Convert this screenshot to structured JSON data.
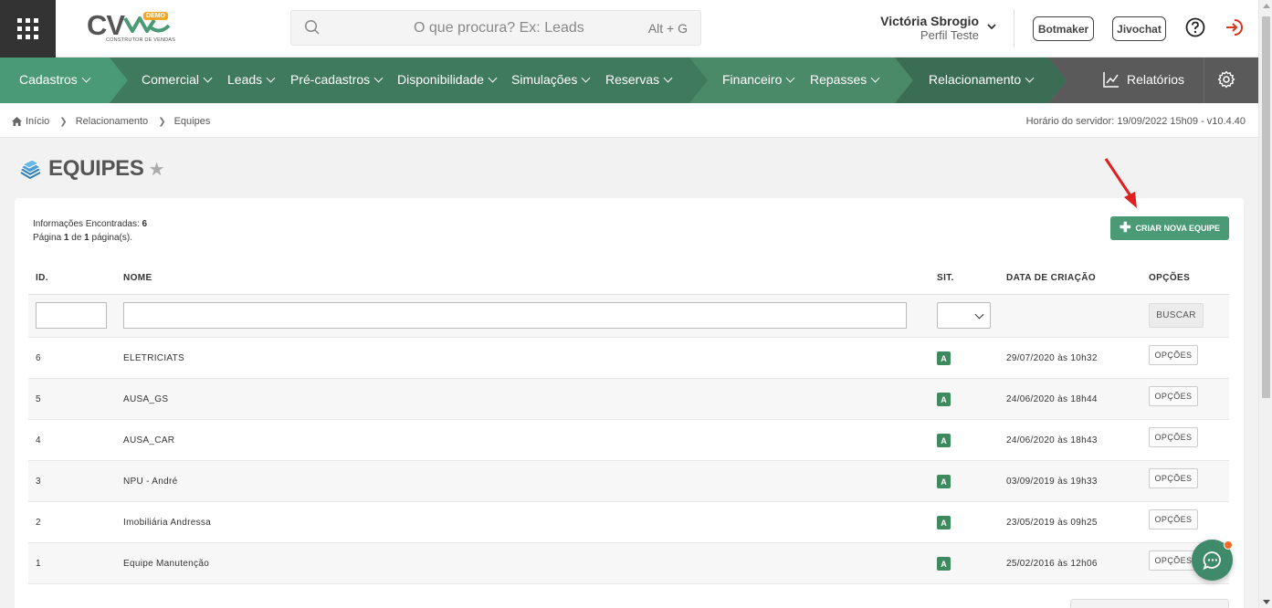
{
  "header": {
    "logo_text": "CV",
    "logo_badge": "DEMO",
    "logo_subtitle": "CONSTRUTOR DE VENDAS",
    "search_placeholder": "O que procura? Ex: Leads",
    "search_shortcut": "Alt + G",
    "user_name": "Victória Sbrogio",
    "user_profile": "Perfil Teste",
    "botmaker_label": "Botmaker",
    "jivochat_label": "Jivochat",
    "icons": [
      "apps-grid-icon",
      "search-icon",
      "chevron-down-icon",
      "help-icon",
      "logout-icon"
    ]
  },
  "nav": {
    "items": [
      {
        "label": "Cadastros"
      },
      {
        "label": "Comercial"
      },
      {
        "label": "Leads"
      },
      {
        "label": "Pré-cadastros"
      },
      {
        "label": "Disponibilidade"
      },
      {
        "label": "Simulações"
      },
      {
        "label": "Reservas"
      },
      {
        "label": "Financeiro"
      },
      {
        "label": "Repasses"
      },
      {
        "label": "Relacionamento"
      }
    ],
    "reports_label": "Relatórios",
    "colors": {
      "primary": "#4a9a75",
      "dark": "#3f7a5c",
      "darker": "#3a6d54",
      "gray": "#5a5a5a"
    }
  },
  "breadcrumb": {
    "items": [
      "Início",
      "Relacionamento",
      "Equipes"
    ],
    "server_time": "Horário do servidor: 19/09/2022 15h09 - v10.4.40"
  },
  "page": {
    "title": "EQUIPES",
    "info_prefix": "Informações Encontradas: ",
    "info_count": "6",
    "page_prefix": "Página ",
    "page_current": "1",
    "page_mid": " de ",
    "page_total": "1",
    "page_suffix": " página(s).",
    "create_button": "CRIAR NOVA EQUIPE"
  },
  "table": {
    "columns": [
      "ID.",
      "NOME",
      "SIT.",
      "DATA DE CRIAÇÃO",
      "OPÇÕES"
    ],
    "search_button": "BUSCAR",
    "options_label": "OPÇÕES",
    "rows": [
      {
        "id": "6",
        "name": "ELETRICIATS",
        "status": "A",
        "created": "29/07/2020 às 10h32"
      },
      {
        "id": "5",
        "name": "AUSA_GS",
        "status": "A",
        "created": "24/06/2020 às 18h44"
      },
      {
        "id": "4",
        "name": "AUSA_CAR",
        "status": "A",
        "created": "24/06/2020 às 18h43"
      },
      {
        "id": "3",
        "name": "NPU - André",
        "status": "A",
        "created": "03/09/2019 às 19h33"
      },
      {
        "id": "2",
        "name": "Imobiliária Andressa",
        "status": "A",
        "created": "23/05/2019 às 09h25"
      },
      {
        "id": "1",
        "name": "Equipe Manutenção",
        "status": "A",
        "created": "25/02/2016 às 12h06"
      }
    ]
  }
}
